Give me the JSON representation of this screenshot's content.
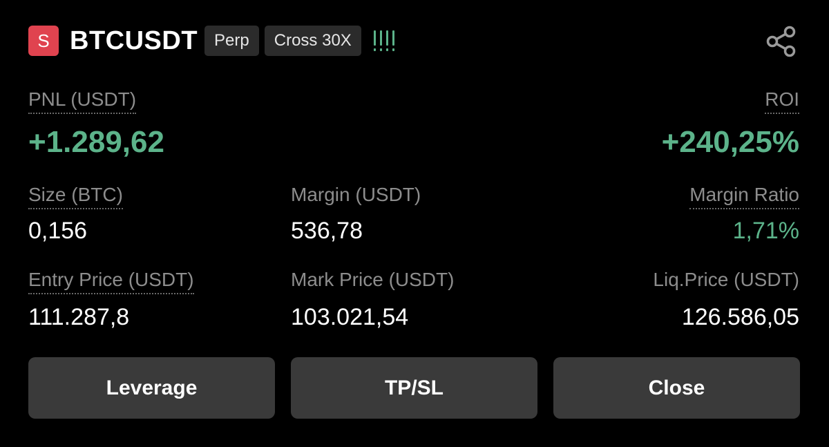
{
  "header": {
    "side_badge": "S",
    "symbol": "BTCUSDT",
    "tags": [
      "Perp",
      "Cross 30X"
    ],
    "signal_icon": "signal-bars-icon",
    "share_icon": "share-icon"
  },
  "pnl": {
    "label": "PNL (USDT)",
    "value": "+1.289,62"
  },
  "roi": {
    "label": "ROI",
    "value": "+240,25%"
  },
  "stats": {
    "size": {
      "label": "Size (BTC)",
      "value": "0,156"
    },
    "margin": {
      "label": "Margin (USDT)",
      "value": "536,78"
    },
    "margin_ratio": {
      "label": "Margin Ratio",
      "value": "1,71%"
    },
    "entry_price": {
      "label": "Entry Price (USDT)",
      "value": "111.287,8"
    },
    "mark_price": {
      "label": "Mark Price (USDT)",
      "value": "103.021,54"
    },
    "liq_price": {
      "label": "Liq.Price (USDT)",
      "value": "126.586,05"
    }
  },
  "buttons": {
    "leverage": "Leverage",
    "tpsl": "TP/SL",
    "close": "Close"
  },
  "colors": {
    "profit": "#5cb38a",
    "short": "#e0434f",
    "button_bg": "#3a3a3a",
    "tag_bg": "#2b2b2b"
  }
}
